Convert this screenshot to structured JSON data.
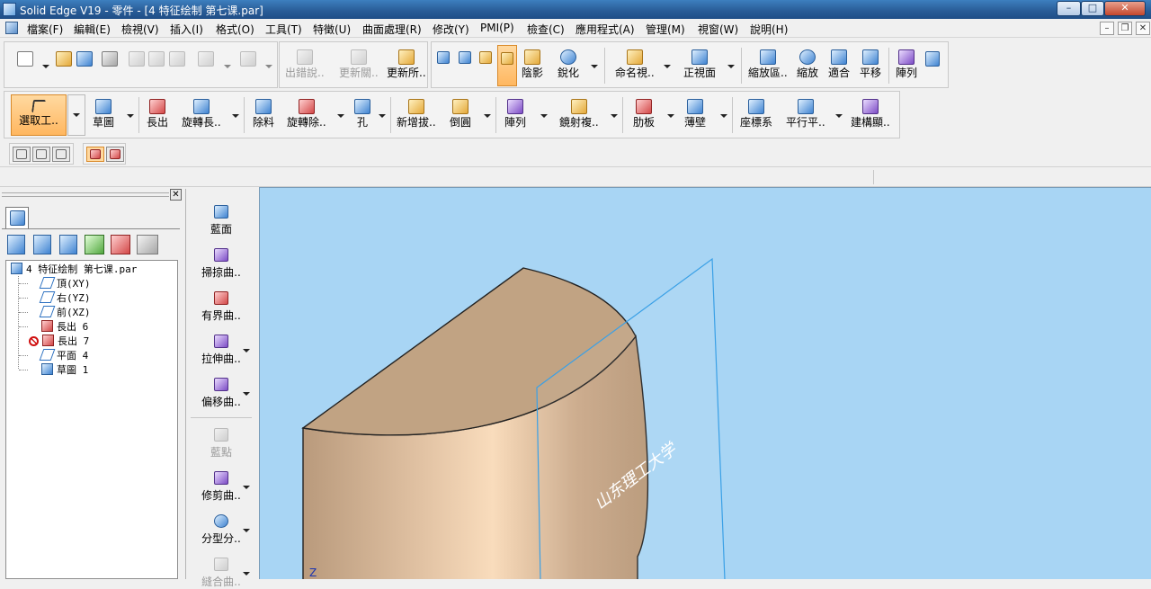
{
  "window": {
    "title": "Solid Edge V19 - 零件 - [4 特征绘制 第七课.par]",
    "controls": [
      "–",
      "□",
      "✕"
    ]
  },
  "menu": {
    "items": [
      "檔案(F)",
      "編輯(E)",
      "檢視(V)",
      "插入(I)",
      "格式(O)",
      "工具(T)",
      "特徵(U)",
      "曲面處理(R)",
      "修改(Y)",
      "PMI(P)",
      "檢查(C)",
      "應用程式(A)",
      "管理(M)",
      "視窗(W)",
      "說明(H)"
    ],
    "mdi_controls": [
      "–",
      "❐",
      "✕"
    ]
  },
  "main_toolbar": {
    "save_group_labels": [
      "出錯說..",
      "更新關..",
      "更新所.."
    ],
    "view_labels": [
      "陰影",
      "銳化",
      "命名視..",
      "正視面",
      "縮放區..",
      "縮放",
      "適合",
      "平移",
      "陣列"
    ]
  },
  "feature_toolbar": {
    "labels": [
      "選取工..",
      "草圖",
      "長出",
      "旋轉長..",
      "除料",
      "旋轉除..",
      "孔",
      "新增拔..",
      "倒圓",
      "陣列",
      "鏡射複..",
      "肋板",
      "薄壁",
      "座標系",
      "平行平..",
      "建構顯.."
    ]
  },
  "feature_library": {
    "items": [
      "藍面",
      "掃掠曲..",
      "有界曲..",
      "拉伸曲..",
      "偏移曲..",
      "藍點",
      "修剪曲..",
      "分型分..",
      "縫合曲.."
    ]
  },
  "tree": {
    "root": "4 特征绘制 第七课.par",
    "items": [
      "頂(XY)",
      "右(YZ)",
      "前(XZ)",
      "長出 6",
      "長出 7",
      "平面 4",
      "草圖 1"
    ]
  },
  "viewport": {
    "watermark": "山东理工大学",
    "axis_label": "Z",
    "colors": {
      "background": "#a8d5f4",
      "body_top": "#c1a383",
      "body_side_light": "#f8d8b7",
      "plane_edge": "#3aa0e6"
    }
  }
}
